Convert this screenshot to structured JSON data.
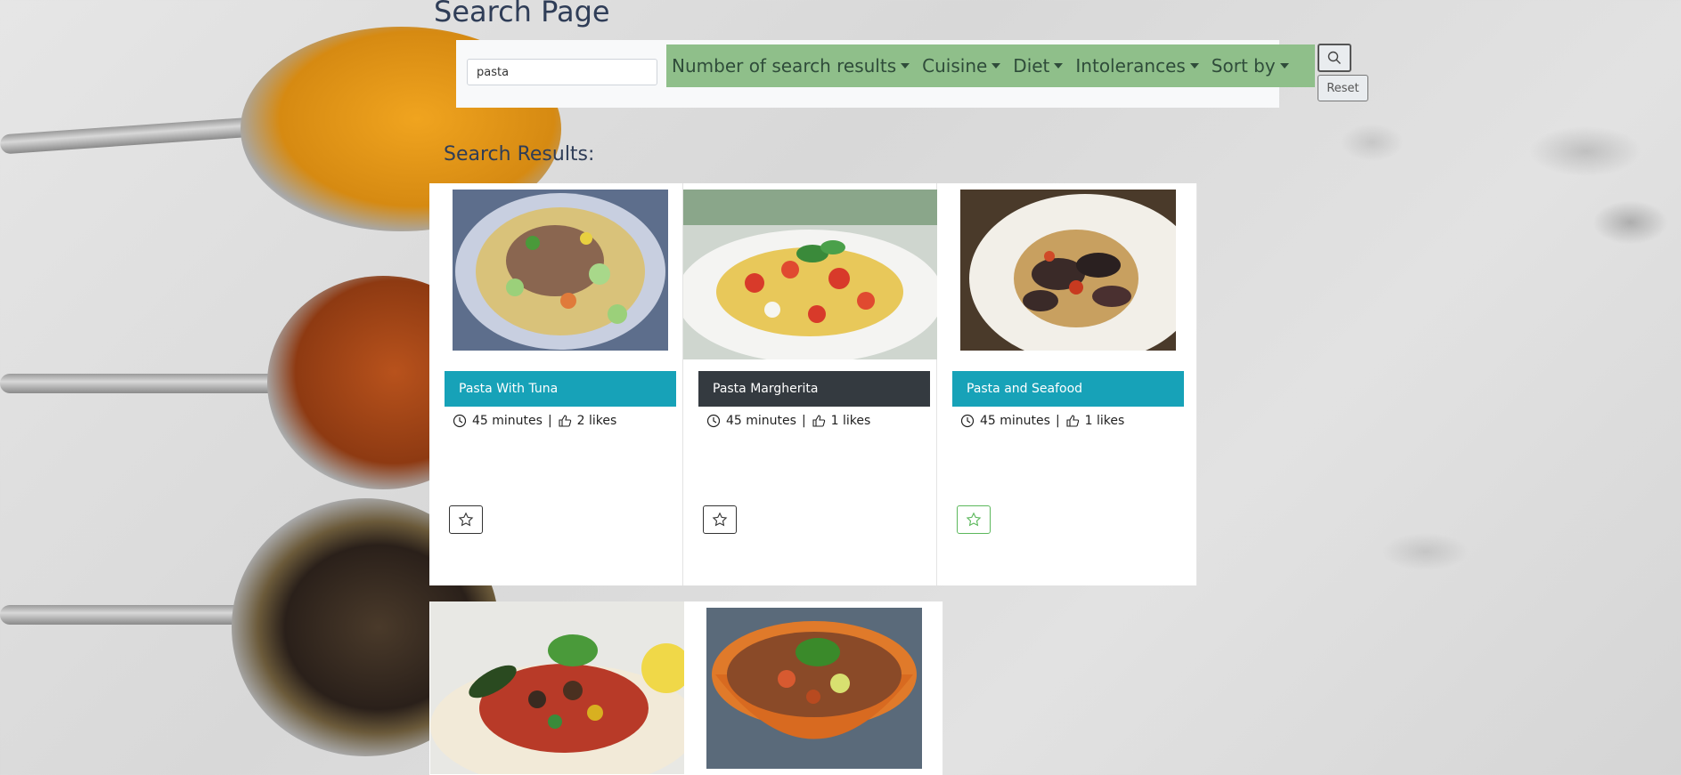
{
  "page": {
    "title": "Search Page",
    "results_heading": "Search Results:"
  },
  "search": {
    "value": "pasta"
  },
  "filters": [
    {
      "label": "Number of search results"
    },
    {
      "label": "Cuisine"
    },
    {
      "label": "Diet"
    },
    {
      "label": "Intolerances"
    },
    {
      "label": "Sort by"
    }
  ],
  "buttons": {
    "reset": "Reset",
    "search_icon": "search-icon"
  },
  "colors": {
    "filter_bg": "#8fbf8a",
    "title_blue": "#17a2b8",
    "title_dark": "#343a40",
    "fav_green": "#5cb85c"
  },
  "recipes": [
    {
      "title": "Pasta With Tuna",
      "time": "45 minutes",
      "likes": "2 likes"
    },
    {
      "title": "Pasta Margherita",
      "time": "45 minutes",
      "likes": "1 likes"
    },
    {
      "title": "Pasta and Seafood",
      "time": "45 minutes",
      "likes": "1 likes"
    }
  ]
}
